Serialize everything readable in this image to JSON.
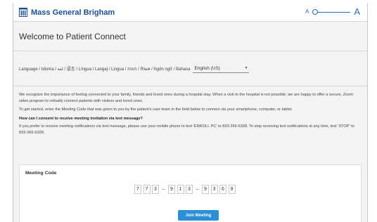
{
  "header": {
    "brand_name": "Mass General Brigham",
    "logo_icon": "hospital-building-icon",
    "font_size_small_label": "A",
    "font_size_large_label": "A",
    "font_size_level": 0,
    "brand_color": "#1b4f8f"
  },
  "page": {
    "title": "Welcome to Patient Connect"
  },
  "language": {
    "label": "Language / Idioma / لغة / 语言 / Língua / Langaj / Lingua / ភាសា / Язык / Ngôn ngữ / Bahasa",
    "selected": "English (US)"
  },
  "info": {
    "p1": "We recognize the importance of feeling connected to your family, friends and loved ones during a hospital stay. When a visit to the hospital is not possible, we are happy to offer a secure, Zoom video program to virtually connect patients with visitors and loved ones.",
    "p2": "To get started, enter the Meeting Code that was given to you by the patient's care team in the field below to connect via your smartphone, computer, or tablet.",
    "question": "How can I consent to receive meeting invitation via text message?",
    "p3": "If you prefer to receive meeting notifications via text message, please use your mobile phone to text 'ENROLL PC' to 833-266-6328. To stop receiving text notifications at any time, text 'STOP' to 833-266-6328."
  },
  "meeting": {
    "label": "Meeting Code",
    "digits": [
      "7",
      "7",
      "3",
      "9",
      "1",
      "3",
      "9",
      "3",
      "6",
      "9"
    ],
    "separator": "–",
    "join_label": "Join Meeting",
    "button_color": "#2a8fd6"
  }
}
